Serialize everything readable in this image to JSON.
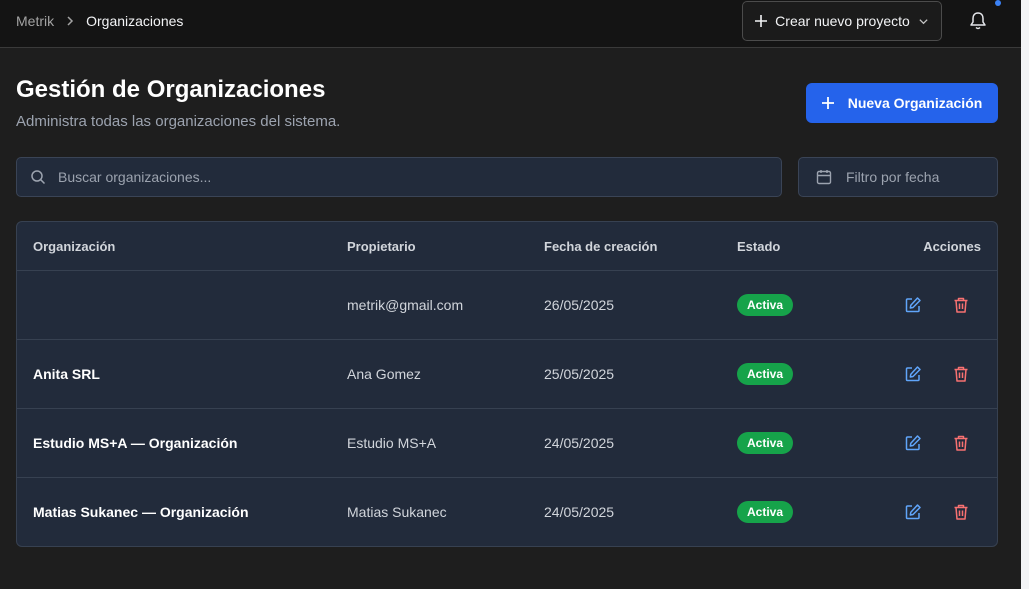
{
  "breadcrumb": {
    "root": "Metrik",
    "current": "Organizaciones"
  },
  "header": {
    "create_project_label": "Crear nuevo proyecto"
  },
  "page": {
    "title": "Gestión de Organizaciones",
    "subtitle": "Administra todas las organizaciones del sistema.",
    "new_org_label": "Nueva Organización"
  },
  "search": {
    "placeholder": "Buscar organizaciones..."
  },
  "date_filter": {
    "placeholder": "Filtro por fecha"
  },
  "table": {
    "columns": [
      "Organización",
      "Propietario",
      "Fecha de creación",
      "Estado",
      "Acciones"
    ],
    "rows": [
      {
        "org": "",
        "owner": "metrik@gmail.com",
        "date": "26/05/2025",
        "status": "Activa"
      },
      {
        "org": "Anita SRL",
        "owner": "Ana Gomez",
        "date": "25/05/2025",
        "status": "Activa"
      },
      {
        "org": "Estudio MS+A — Organización",
        "owner": "Estudio MS+A",
        "date": "24/05/2025",
        "status": "Activa"
      },
      {
        "org": "Matias Sukanec — Organización",
        "owner": "Matias Sukanec",
        "date": "24/05/2025",
        "status": "Activa"
      }
    ]
  },
  "colors": {
    "accent": "#2563eb",
    "status_active": "#16a34a",
    "edit_icon": "#60a5fa",
    "delete_icon": "#f87171"
  },
  "icons": [
    "chevron-right-icon",
    "plus-icon",
    "chevron-down-icon",
    "bell-icon",
    "search-icon",
    "calendar-icon",
    "edit-icon",
    "trash-icon"
  ]
}
